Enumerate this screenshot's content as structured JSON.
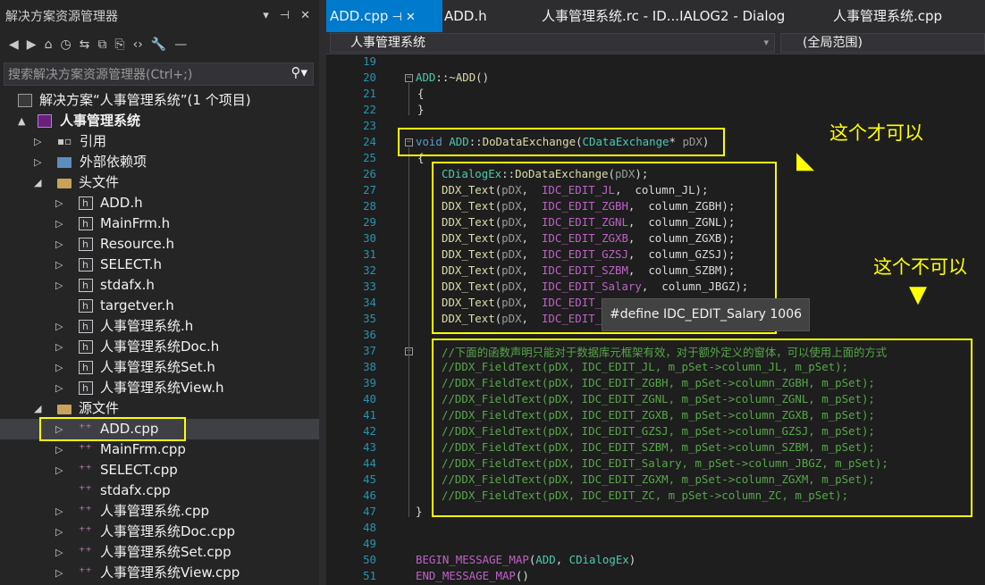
{
  "solution_explorer": {
    "title": "解决方案资源管理器",
    "toolbar_icons": [
      "back-icon",
      "forward-icon",
      "home-icon",
      "history-icon",
      "sync-icon",
      "collapse-icon",
      "copy-icon",
      "code-icon",
      "wrench-icon",
      "minus-icon"
    ],
    "search_placeholder": "搜索解决方案资源管理器(Ctrl+;)",
    "tree": [
      {
        "label": "解决方案“人事管理系统”(1 个项目)",
        "kind": "solution",
        "level": 0,
        "arrow": ""
      },
      {
        "label": "人事管理系统",
        "kind": "project",
        "level": 0,
        "arrow": "▲"
      },
      {
        "label": "引用",
        "kind": "ref",
        "level": 1,
        "arrow": "▷"
      },
      {
        "label": "外部依赖项",
        "kind": "ext",
        "level": 1,
        "arrow": "▷"
      },
      {
        "label": "头文件",
        "kind": "folder",
        "level": 1,
        "arrow": "◢"
      },
      {
        "label": "ADD.h",
        "kind": "h",
        "level": 2,
        "arrow": "▷"
      },
      {
        "label": "MainFrm.h",
        "kind": "h",
        "level": 2,
        "arrow": "▷"
      },
      {
        "label": "Resource.h",
        "kind": "h",
        "level": 2,
        "arrow": "▷"
      },
      {
        "label": "SELECT.h",
        "kind": "h",
        "level": 2,
        "arrow": "▷"
      },
      {
        "label": "stdafx.h",
        "kind": "h",
        "level": 2,
        "arrow": "▷"
      },
      {
        "label": "targetver.h",
        "kind": "h",
        "level": 2,
        "arrow": ""
      },
      {
        "label": "人事管理系统.h",
        "kind": "h",
        "level": 2,
        "arrow": "▷"
      },
      {
        "label": "人事管理系统Doc.h",
        "kind": "h",
        "level": 2,
        "arrow": "▷"
      },
      {
        "label": "人事管理系统Set.h",
        "kind": "h",
        "level": 2,
        "arrow": "▷"
      },
      {
        "label": "人事管理系统View.h",
        "kind": "h",
        "level": 2,
        "arrow": "▷"
      },
      {
        "label": "源文件",
        "kind": "folder",
        "level": 1,
        "arrow": "◢"
      },
      {
        "label": "ADD.cpp",
        "kind": "cpp",
        "level": 2,
        "arrow": "▷",
        "selected": true
      },
      {
        "label": "MainFrm.cpp",
        "kind": "cpp",
        "level": 2,
        "arrow": "▷"
      },
      {
        "label": "SELECT.cpp",
        "kind": "cpp",
        "level": 2,
        "arrow": "▷"
      },
      {
        "label": "stdafx.cpp",
        "kind": "cpp",
        "level": 2,
        "arrow": ""
      },
      {
        "label": "人事管理系统.cpp",
        "kind": "cpp",
        "level": 2,
        "arrow": "▷"
      },
      {
        "label": "人事管理系统Doc.cpp",
        "kind": "cpp",
        "level": 2,
        "arrow": "▷"
      },
      {
        "label": "人事管理系统Set.cpp",
        "kind": "cpp",
        "level": 2,
        "arrow": "▷"
      },
      {
        "label": "人事管理系统View.cpp",
        "kind": "cpp",
        "level": 2,
        "arrow": "▷"
      }
    ]
  },
  "editor": {
    "tabs": [
      {
        "label": "ADD.cpp",
        "active": true
      },
      {
        "label": "ADD.h"
      },
      {
        "label": "人事管理系统.rc - ID...IALOG2 - Dialog"
      },
      {
        "label": "人事管理系统.cpp"
      }
    ],
    "nav_scope": "人事管理系统",
    "nav_member": "(全局范围)",
    "tooltip": "#define IDC_EDIT_Salary 1006",
    "annotation_ok": "这个才可以",
    "annotation_not_ok": "这个不可以",
    "lines": [
      {
        "n": "19",
        "segs": []
      },
      {
        "n": "20",
        "segs": [
          [
            "ty",
            "ADD"
          ],
          [
            "",
            "::~"
          ],
          [
            "fn",
            "ADD"
          ],
          [
            "",
            "()"
          ]
        ]
      },
      {
        "n": "21",
        "segs": [
          [
            "",
            "{"
          ]
        ]
      },
      {
        "n": "22",
        "segs": [
          [
            "",
            "}"
          ]
        ]
      },
      {
        "n": "23",
        "segs": []
      },
      {
        "n": "24",
        "segs": [
          [
            "kw",
            "void "
          ],
          [
            "ty",
            "ADD"
          ],
          [
            "",
            "::"
          ],
          [
            "fn",
            "DoDataExchange"
          ],
          [
            "",
            "("
          ],
          [
            "ty",
            "CDataExchange"
          ],
          [
            "",
            "* "
          ],
          [
            "pr",
            "pDX"
          ],
          [
            "",
            ")"
          ]
        ]
      },
      {
        "n": "25",
        "segs": [
          [
            "",
            "{"
          ]
        ]
      },
      {
        "n": "26",
        "segs": [
          [
            "ty",
            "CDialogEx"
          ],
          [
            "",
            "::"
          ],
          [
            "fn",
            "DoDataExchange"
          ],
          [
            "",
            "("
          ],
          [
            "pr",
            "pDX"
          ],
          [
            "",
            ");"
          ]
        ]
      },
      {
        "n": "27",
        "segs": [
          [
            "fn",
            "DDX_Text"
          ],
          [
            "",
            "("
          ],
          [
            "pr",
            "pDX"
          ],
          [
            "",
            ",  "
          ],
          [
            "mac",
            "IDC_EDIT_JL"
          ],
          [
            "",
            ",  "
          ],
          [
            "var",
            "column_JL"
          ],
          [
            "",
            ");"
          ]
        ]
      },
      {
        "n": "28",
        "segs": [
          [
            "fn",
            "DDX_Text"
          ],
          [
            "",
            "("
          ],
          [
            "pr",
            "pDX"
          ],
          [
            "",
            ",  "
          ],
          [
            "mac",
            "IDC_EDIT_ZGBH"
          ],
          [
            "",
            ",  "
          ],
          [
            "var",
            "column_ZGBH"
          ],
          [
            "",
            ");"
          ]
        ]
      },
      {
        "n": "29",
        "segs": [
          [
            "fn",
            "DDX_Text"
          ],
          [
            "",
            "("
          ],
          [
            "pr",
            "pDX"
          ],
          [
            "",
            ",  "
          ],
          [
            "mac",
            "IDC_EDIT_ZGNL"
          ],
          [
            "",
            ",  "
          ],
          [
            "var",
            "column_ZGNL"
          ],
          [
            "",
            ");"
          ]
        ]
      },
      {
        "n": "30",
        "segs": [
          [
            "fn",
            "DDX_Text"
          ],
          [
            "",
            "("
          ],
          [
            "pr",
            "pDX"
          ],
          [
            "",
            ",  "
          ],
          [
            "mac",
            "IDC_EDIT_ZGXB"
          ],
          [
            "",
            ",  "
          ],
          [
            "var",
            "column_ZGXB"
          ],
          [
            "",
            ");"
          ]
        ]
      },
      {
        "n": "31",
        "segs": [
          [
            "fn",
            "DDX_Text"
          ],
          [
            "",
            "("
          ],
          [
            "pr",
            "pDX"
          ],
          [
            "",
            ",  "
          ],
          [
            "mac",
            "IDC_EDIT_GZSJ"
          ],
          [
            "",
            ",  "
          ],
          [
            "var",
            "column_GZSJ"
          ],
          [
            "",
            ");"
          ]
        ]
      },
      {
        "n": "32",
        "segs": [
          [
            "fn",
            "DDX_Text"
          ],
          [
            "",
            "("
          ],
          [
            "pr",
            "pDX"
          ],
          [
            "",
            ",  "
          ],
          [
            "mac",
            "IDC_EDIT_SZBM"
          ],
          [
            "",
            ",  "
          ],
          [
            "var",
            "column_SZBM"
          ],
          [
            "",
            ");"
          ]
        ]
      },
      {
        "n": "33",
        "segs": [
          [
            "fn",
            "DDX_Text"
          ],
          [
            "",
            "("
          ],
          [
            "pr",
            "pDX"
          ],
          [
            "",
            ",  "
          ],
          [
            "mac",
            "IDC_EDIT_Salary"
          ],
          [
            "",
            ",  "
          ],
          [
            "var",
            "column_JBGZ"
          ],
          [
            "",
            ");"
          ]
        ]
      },
      {
        "n": "34",
        "segs": [
          [
            "fn",
            "DDX_Text"
          ],
          [
            "",
            "("
          ],
          [
            "pr",
            "pDX"
          ],
          [
            "",
            ",  "
          ],
          [
            "mac",
            "IDC_EDIT_ZG"
          ]
        ]
      },
      {
        "n": "35",
        "segs": [
          [
            "fn",
            "DDX_Text"
          ],
          [
            "",
            "("
          ],
          [
            "pr",
            "pDX"
          ],
          [
            "",
            ",  "
          ],
          [
            "mac",
            "IDC_EDIT_ZC"
          ]
        ]
      },
      {
        "n": "36",
        "segs": []
      },
      {
        "n": "37",
        "segs": [
          [
            "cm",
            "//下面的函数声明只能对于数据库元框架有效，对于额外定义的窗体，可以使用上面的方式"
          ]
        ]
      },
      {
        "n": "38",
        "segs": [
          [
            "cm",
            "//DDX_FieldText(pDX, IDC_EDIT_JL, m_pSet->column_JL, m_pSet);"
          ]
        ]
      },
      {
        "n": "39",
        "segs": [
          [
            "cm",
            "//DDX_FieldText(pDX, IDC_EDIT_ZGBH, m_pSet->column_ZGBH, m_pSet);"
          ]
        ]
      },
      {
        "n": "40",
        "segs": [
          [
            "cm",
            "//DDX_FieldText(pDX, IDC_EDIT_ZGNL, m_pSet->column_ZGNL, m_pSet);"
          ]
        ]
      },
      {
        "n": "41",
        "segs": [
          [
            "cm",
            "//DDX_FieldText(pDX, IDC_EDIT_ZGXB, m_pSet->column_ZGXB, m_pSet);"
          ]
        ]
      },
      {
        "n": "42",
        "segs": [
          [
            "cm",
            "//DDX_FieldText(pDX, IDC_EDIT_GZSJ, m_pSet->column_GZSJ, m_pSet);"
          ]
        ]
      },
      {
        "n": "43",
        "segs": [
          [
            "cm",
            "//DDX_FieldText(pDX, IDC_EDIT_SZBM, m_pSet->column_SZBM, m_pSet);"
          ]
        ]
      },
      {
        "n": "44",
        "segs": [
          [
            "cm",
            "//DDX_FieldText(pDX, IDC_EDIT_Salary, m_pSet->column_JBGZ, m_pSet);"
          ]
        ]
      },
      {
        "n": "45",
        "segs": [
          [
            "cm",
            "//DDX_FieldText(pDX, IDC_EDIT_ZGXM, m_pSet->column_ZGXM, m_pSet);"
          ]
        ]
      },
      {
        "n": "46",
        "segs": [
          [
            "cm",
            "//DDX_FieldText(pDX, IDC_EDIT_ZC, m_pSet->column_ZC, m_pSet);"
          ]
        ]
      },
      {
        "n": "47",
        "segs": [
          [
            "",
            "}"
          ]
        ]
      },
      {
        "n": "48",
        "segs": []
      },
      {
        "n": "49",
        "segs": []
      },
      {
        "n": "50",
        "segs": [
          [
            "mac",
            "BEGIN_MESSAGE_MAP"
          ],
          [
            "",
            "("
          ],
          [
            "ty",
            "ADD"
          ],
          [
            "",
            ", "
          ],
          [
            "ty",
            "CDialogEx"
          ],
          [
            "",
            ")"
          ]
        ]
      },
      {
        "n": "51",
        "segs": [
          [
            "mac",
            "END_MESSAGE_MAP"
          ],
          [
            "",
            "()"
          ]
        ]
      }
    ]
  }
}
